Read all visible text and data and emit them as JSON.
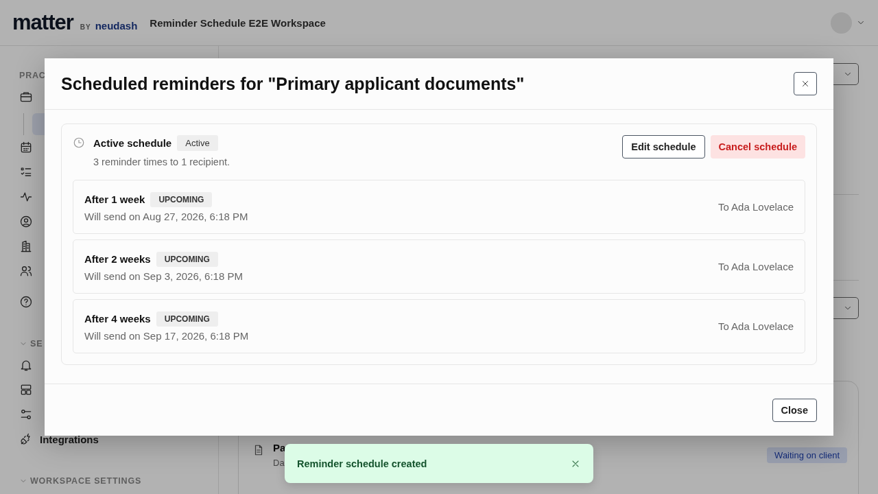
{
  "header": {
    "logo_main": "matter",
    "logo_by": "BY",
    "logo_brand": "neudash",
    "workspace": "Reminder Schedule E2E Workspace"
  },
  "sidebar": [
    {
      "kind": "section",
      "label": "PRAC",
      "expanded": false
    },
    {
      "kind": "item",
      "selected": false
    },
    {
      "kind": "subitem",
      "selected": true
    },
    {
      "kind": "item",
      "selected": false
    },
    {
      "kind": "item",
      "selected": false
    },
    {
      "kind": "item",
      "selected": false
    },
    {
      "kind": "item",
      "selected": false
    },
    {
      "kind": "item",
      "selected": false
    },
    {
      "kind": "item",
      "selected": false
    },
    {
      "kind": "item",
      "selected": false
    },
    {
      "kind": "section",
      "label": "SE",
      "expanded": true
    },
    {
      "kind": "item",
      "selected": false
    },
    {
      "kind": "item",
      "selected": false
    },
    {
      "kind": "item",
      "selected": false
    },
    {
      "kind": "item",
      "label": "Integrations",
      "selected": false
    },
    {
      "kind": "section",
      "label": "WORKSPACE SETTINGS",
      "expanded": true
    }
  ],
  "background_row": {
    "title": "Pa",
    "subtitle": "Da",
    "status": "Waiting on client"
  },
  "dialog": {
    "title": "Scheduled reminders for \"Primary applicant documents\"",
    "schedule": {
      "title": "Active schedule",
      "status": "Active",
      "summary": "3 reminder times to 1 recipient.",
      "edit_button": "Edit schedule",
      "cancel_button": "Cancel schedule"
    },
    "reminders": [
      {
        "title": "After 1 week",
        "status": "UPCOMING",
        "when": "Will send on Aug 27, 2026, 6:18 PM",
        "recipient": "To Ada Lovelace"
      },
      {
        "title": "After 2 weeks",
        "status": "UPCOMING",
        "when": "Will send on Sep 3, 2026, 6:18 PM",
        "recipient": "To Ada Lovelace"
      },
      {
        "title": "After 4 weeks",
        "status": "UPCOMING",
        "when": "Will send on Sep 17, 2026, 6:18 PM",
        "recipient": "To Ada Lovelace"
      }
    ],
    "close_button": "Close"
  },
  "toast": {
    "message": "Reminder schedule created"
  }
}
